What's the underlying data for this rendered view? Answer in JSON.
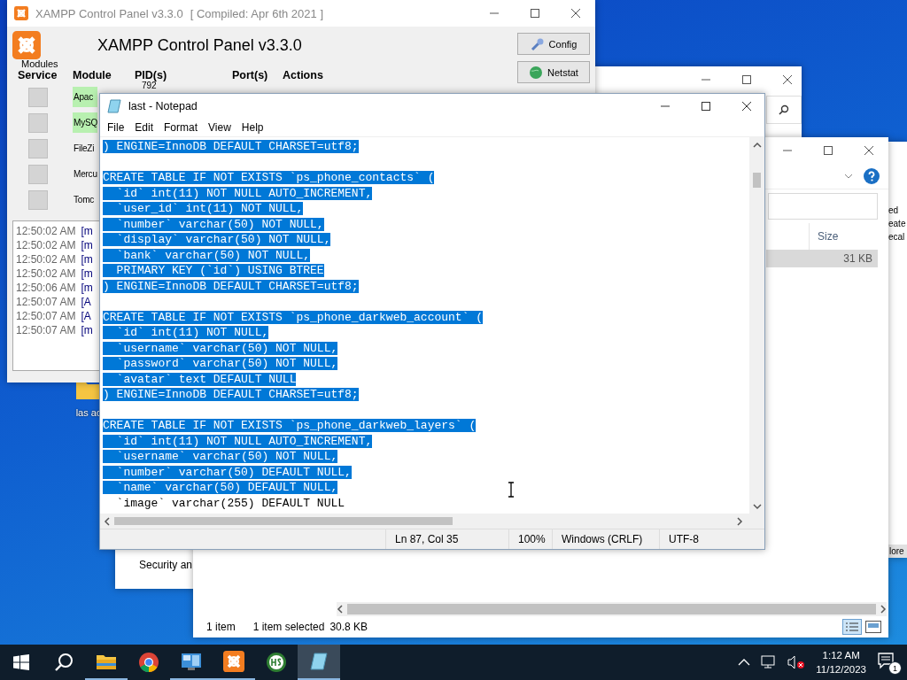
{
  "desktop": {
    "icons": [
      {
        "label": "las ac"
      }
    ]
  },
  "xampp": {
    "title": "XAMPP Control Panel v3.3.0",
    "compiled": "[ Compiled: Apr 6th 2021 ]",
    "heading": "XAMPP Control Panel v3.3.0",
    "group_label": "Modules",
    "columns": [
      "Service",
      "Module",
      "PID(s)",
      "Port(s)",
      "Actions"
    ],
    "modules": [
      {
        "name": "Apac",
        "pid": "792",
        "running": true,
        "checked": false
      },
      {
        "name": "MySQ",
        "running": true,
        "checked": false
      },
      {
        "name": "FileZi",
        "running": false,
        "checked": false
      },
      {
        "name": "Mercu",
        "running": false,
        "checked": false
      },
      {
        "name": "Tomc",
        "running": false,
        "checked": false
      }
    ],
    "buttons": [
      {
        "label": "Config",
        "kind": "config"
      },
      {
        "label": "Netstat",
        "kind": "netstat"
      }
    ],
    "log": [
      {
        "time": "12:50:02 AM",
        "source": "[m"
      },
      {
        "time": "12:50:02 AM",
        "source": "[m"
      },
      {
        "time": "12:50:02 AM",
        "source": "[m"
      },
      {
        "time": "12:50:02 AM",
        "source": "[m"
      },
      {
        "time": "12:50:06 AM",
        "source": "[m"
      },
      {
        "time": "12:50:07 AM",
        "source": "[A"
      },
      {
        "time": "12:50:07 AM",
        "source": "[A"
      },
      {
        "time": "12:50:07 AM",
        "source": "[m"
      }
    ]
  },
  "control_panel": {
    "text": "Security an"
  },
  "side_window": {
    "lines": [
      "ed",
      "eate",
      "ecal"
    ],
    "button": "lore"
  },
  "explorer": {
    "column": "Size",
    "rows": [
      {
        "size": "31 KB",
        "selected": true
      }
    ],
    "status": {
      "count": "1 item",
      "selection": "1 item selected",
      "size": "30.8 KB"
    }
  },
  "notepad": {
    "title": "last - Notepad",
    "menu": [
      "File",
      "Edit",
      "Format",
      "View",
      "Help"
    ],
    "lines": [
      {
        "kind": "code",
        "text": ") ENGINE=InnoDB DEFAULT CHARSET=utf8;",
        "selected": true
      },
      {
        "kind": "blank"
      },
      {
        "kind": "code",
        "text": "CREATE TABLE IF NOT EXISTS `ps_phone_contacts` (",
        "selected": true
      },
      {
        "kind": "code",
        "text": "  `id` int(11) NOT NULL AUTO_INCREMENT,",
        "selected": true
      },
      {
        "kind": "code",
        "text": "  `user_id` int(11) NOT NULL,",
        "selected": true
      },
      {
        "kind": "code",
        "text": "  `number` varchar(50) NOT NULL,",
        "selected": true
      },
      {
        "kind": "code",
        "text": "  `display` varchar(50) NOT NULL,",
        "selected": true
      },
      {
        "kind": "code",
        "text": "  `bank` varchar(50) NOT NULL,",
        "selected": true
      },
      {
        "kind": "code",
        "text": "  PRIMARY KEY (`id`) USING BTREE",
        "selected": true
      },
      {
        "kind": "code",
        "text": ") ENGINE=InnoDB DEFAULT CHARSET=utf8;",
        "selected": true
      },
      {
        "kind": "blank"
      },
      {
        "kind": "code",
        "text": "CREATE TABLE IF NOT EXISTS `ps_phone_darkweb_account` (",
        "selected": true
      },
      {
        "kind": "code",
        "text": "  `id` int(11) NOT NULL,",
        "selected": true
      },
      {
        "kind": "code",
        "text": "  `username` varchar(50) NOT NULL,",
        "selected": true
      },
      {
        "kind": "code",
        "text": "  `password` varchar(50) NOT NULL,",
        "selected": true
      },
      {
        "kind": "code",
        "text": "  `avatar` text DEFAULT NULL",
        "selected": true
      },
      {
        "kind": "code",
        "text": ") ENGINE=InnoDB DEFAULT CHARSET=utf8;",
        "selected": true
      },
      {
        "kind": "blank"
      },
      {
        "kind": "code",
        "text": "CREATE TABLE IF NOT EXISTS `ps_phone_darkweb_layers` (",
        "selected": true
      },
      {
        "kind": "code",
        "text": "  `id` int(11) NOT NULL AUTO_INCREMENT,",
        "selected": true
      },
      {
        "kind": "code",
        "text": "  `username` varchar(50) NOT NULL,",
        "selected": true
      },
      {
        "kind": "code",
        "text": "  `number` varchar(50) DEFAULT NULL,",
        "selected": true
      },
      {
        "kind": "code",
        "text": "  `name` varchar(50) DEFAULT NULL,",
        "selected": true
      },
      {
        "kind": "code",
        "text": "  `image` varchar(255) DEFAULT NULL",
        "selected": false
      }
    ],
    "status": {
      "position": "Ln 87, Col 35",
      "zoom": "100%",
      "line_endings": "Windows (CRLF)",
      "encoding": "UTF-8"
    }
  },
  "taskbar": {
    "apps": [
      {
        "kind": "explorer",
        "running": true,
        "selected": false
      },
      {
        "kind": "chrome",
        "running": false,
        "selected": false
      },
      {
        "kind": "control",
        "running": true,
        "selected": false
      },
      {
        "kind": "xampp",
        "running": true,
        "selected": false
      },
      {
        "kind": "hs",
        "running": false,
        "selected": false
      },
      {
        "kind": "notepad",
        "running": true,
        "selected": true
      }
    ],
    "time": "1:12 AM",
    "date": "11/12/2023",
    "notifications": "1"
  }
}
